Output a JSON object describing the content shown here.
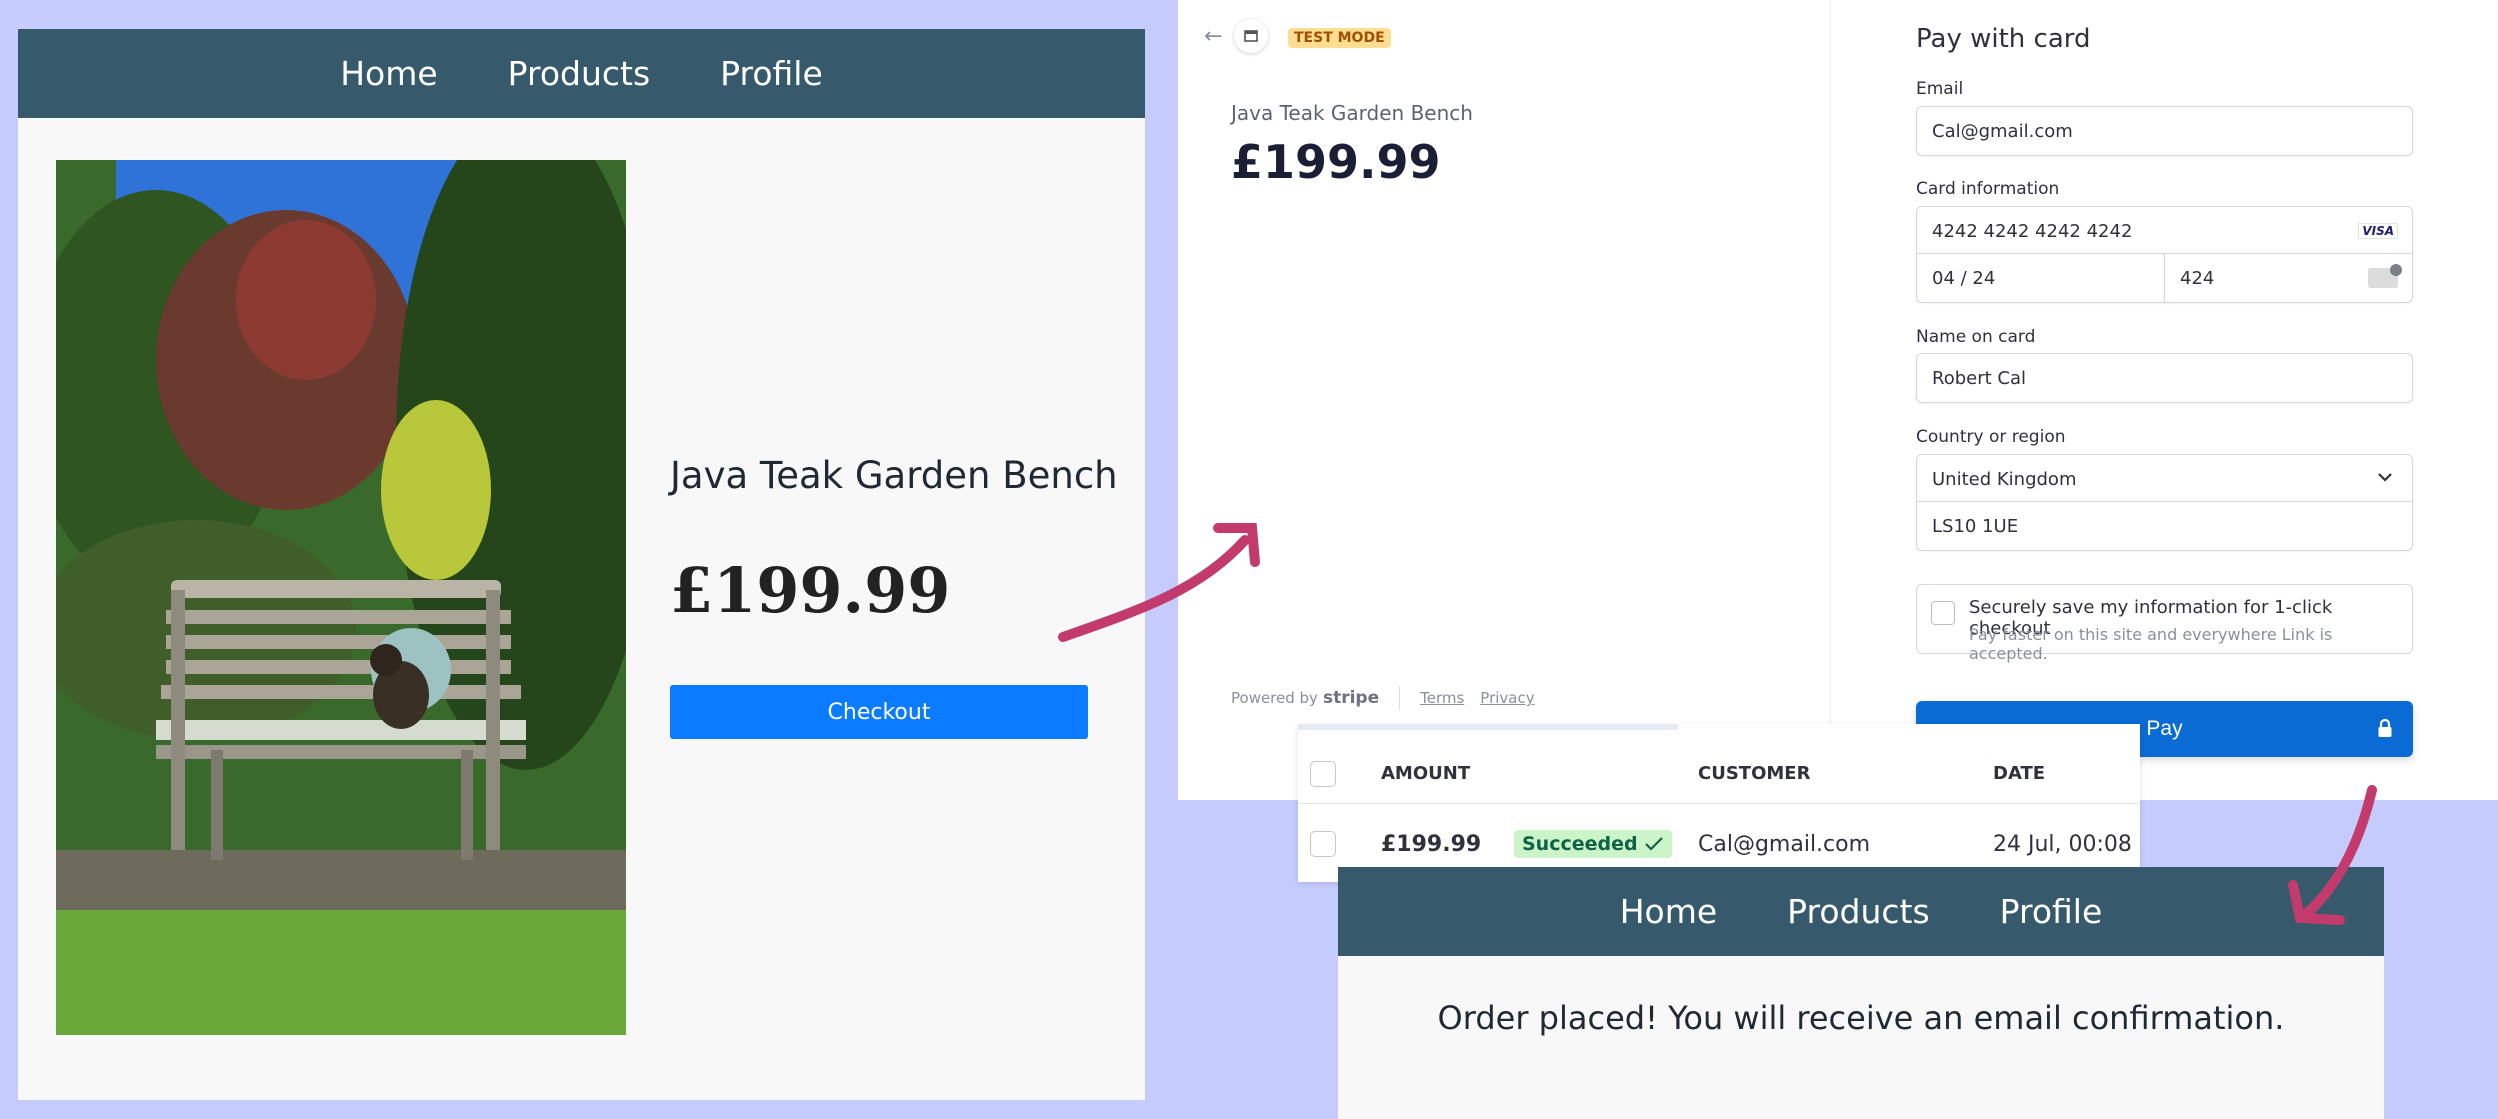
{
  "shop": {
    "nav": [
      "Home",
      "Products",
      "Profile"
    ],
    "product_title": "Java Teak Garden Bench",
    "product_price": "£199.99",
    "checkout_label": "Checkout"
  },
  "stripe": {
    "test_mode": "TEST MODE",
    "product_name": "Java Teak Garden Bench",
    "price": "£199.99",
    "footer": {
      "powered_by": "Powered by",
      "brand": "stripe",
      "terms": "Terms",
      "privacy": "Privacy"
    },
    "form": {
      "heading": "Pay with card",
      "email_label": "Email",
      "email_value": "Cal@gmail.com",
      "card_label": "Card information",
      "card_number": "4242 4242 4242 4242",
      "card_brand": "VISA",
      "card_expiry": "04 / 24",
      "card_cvc": "424",
      "name_label": "Name on card",
      "name_value": "Robert Cal",
      "country_label": "Country or region",
      "country_value": "United Kingdom",
      "postal_value": "LS10 1UE",
      "save_label": "Securely save my information for 1-click checkout",
      "save_sublabel": "Pay faster on this site and everywhere Link is accepted.",
      "pay_label": "Pay"
    }
  },
  "payments": {
    "headers": {
      "amount": "AMOUNT",
      "customer": "CUSTOMER",
      "date": "DATE"
    },
    "row": {
      "amount": "£199.99",
      "status": "Succeeded",
      "customer": "Cal@gmail.com",
      "date": "24 Jul, 00:08"
    }
  },
  "confirmation": {
    "nav": [
      "Home",
      "Products",
      "Profile"
    ],
    "message": "Order placed! You will receive an email confirmation."
  },
  "colors": {
    "background": "#c5ccfd",
    "nav": "#365a6c",
    "checkout_button": "#0b7cff",
    "pay_button": "#0a6bd4",
    "arrow": "#c23b6c",
    "status_badge": "#cbf4c9"
  }
}
